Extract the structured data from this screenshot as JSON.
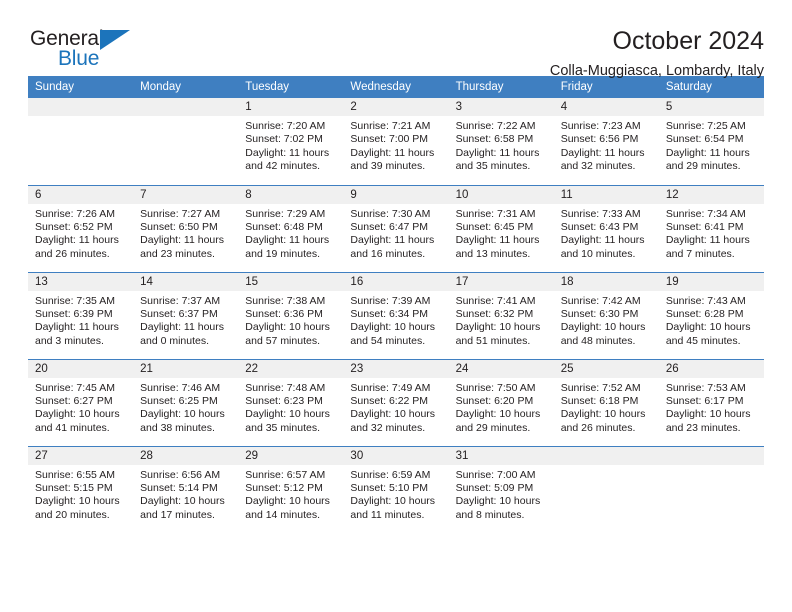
{
  "logo": {
    "text_dark": "General",
    "text_blue": "Blue",
    "triangle_icon": "triangle-icon"
  },
  "header": {
    "title": "October 2024",
    "subtitle": "Colla-Muggiasca, Lombardy, Italy"
  },
  "colors": {
    "header_blue": "#3f7fc1",
    "logo_blue": "#1c74bb",
    "daynum_bg": "#f0f0f0",
    "text": "#231f20"
  },
  "weekdays": [
    "Sunday",
    "Monday",
    "Tuesday",
    "Wednesday",
    "Thursday",
    "Friday",
    "Saturday"
  ],
  "weeks": [
    [
      {
        "day": "",
        "lines": []
      },
      {
        "day": "",
        "lines": []
      },
      {
        "day": "1",
        "lines": [
          "Sunrise: 7:20 AM",
          "Sunset: 7:02 PM",
          "Daylight: 11 hours",
          "and 42 minutes."
        ]
      },
      {
        "day": "2",
        "lines": [
          "Sunrise: 7:21 AM",
          "Sunset: 7:00 PM",
          "Daylight: 11 hours",
          "and 39 minutes."
        ]
      },
      {
        "day": "3",
        "lines": [
          "Sunrise: 7:22 AM",
          "Sunset: 6:58 PM",
          "Daylight: 11 hours",
          "and 35 minutes."
        ]
      },
      {
        "day": "4",
        "lines": [
          "Sunrise: 7:23 AM",
          "Sunset: 6:56 PM",
          "Daylight: 11 hours",
          "and 32 minutes."
        ]
      },
      {
        "day": "5",
        "lines": [
          "Sunrise: 7:25 AM",
          "Sunset: 6:54 PM",
          "Daylight: 11 hours",
          "and 29 minutes."
        ]
      }
    ],
    [
      {
        "day": "6",
        "lines": [
          "Sunrise: 7:26 AM",
          "Sunset: 6:52 PM",
          "Daylight: 11 hours",
          "and 26 minutes."
        ]
      },
      {
        "day": "7",
        "lines": [
          "Sunrise: 7:27 AM",
          "Sunset: 6:50 PM",
          "Daylight: 11 hours",
          "and 23 minutes."
        ]
      },
      {
        "day": "8",
        "lines": [
          "Sunrise: 7:29 AM",
          "Sunset: 6:48 PM",
          "Daylight: 11 hours",
          "and 19 minutes."
        ]
      },
      {
        "day": "9",
        "lines": [
          "Sunrise: 7:30 AM",
          "Sunset: 6:47 PM",
          "Daylight: 11 hours",
          "and 16 minutes."
        ]
      },
      {
        "day": "10",
        "lines": [
          "Sunrise: 7:31 AM",
          "Sunset: 6:45 PM",
          "Daylight: 11 hours",
          "and 13 minutes."
        ]
      },
      {
        "day": "11",
        "lines": [
          "Sunrise: 7:33 AM",
          "Sunset: 6:43 PM",
          "Daylight: 11 hours",
          "and 10 minutes."
        ]
      },
      {
        "day": "12",
        "lines": [
          "Sunrise: 7:34 AM",
          "Sunset: 6:41 PM",
          "Daylight: 11 hours",
          "and 7 minutes."
        ]
      }
    ],
    [
      {
        "day": "13",
        "lines": [
          "Sunrise: 7:35 AM",
          "Sunset: 6:39 PM",
          "Daylight: 11 hours",
          "and 3 minutes."
        ]
      },
      {
        "day": "14",
        "lines": [
          "Sunrise: 7:37 AM",
          "Sunset: 6:37 PM",
          "Daylight: 11 hours",
          "and 0 minutes."
        ]
      },
      {
        "day": "15",
        "lines": [
          "Sunrise: 7:38 AM",
          "Sunset: 6:36 PM",
          "Daylight: 10 hours",
          "and 57 minutes."
        ]
      },
      {
        "day": "16",
        "lines": [
          "Sunrise: 7:39 AM",
          "Sunset: 6:34 PM",
          "Daylight: 10 hours",
          "and 54 minutes."
        ]
      },
      {
        "day": "17",
        "lines": [
          "Sunrise: 7:41 AM",
          "Sunset: 6:32 PM",
          "Daylight: 10 hours",
          "and 51 minutes."
        ]
      },
      {
        "day": "18",
        "lines": [
          "Sunrise: 7:42 AM",
          "Sunset: 6:30 PM",
          "Daylight: 10 hours",
          "and 48 minutes."
        ]
      },
      {
        "day": "19",
        "lines": [
          "Sunrise: 7:43 AM",
          "Sunset: 6:28 PM",
          "Daylight: 10 hours",
          "and 45 minutes."
        ]
      }
    ],
    [
      {
        "day": "20",
        "lines": [
          "Sunrise: 7:45 AM",
          "Sunset: 6:27 PM",
          "Daylight: 10 hours",
          "and 41 minutes."
        ]
      },
      {
        "day": "21",
        "lines": [
          "Sunrise: 7:46 AM",
          "Sunset: 6:25 PM",
          "Daylight: 10 hours",
          "and 38 minutes."
        ]
      },
      {
        "day": "22",
        "lines": [
          "Sunrise: 7:48 AM",
          "Sunset: 6:23 PM",
          "Daylight: 10 hours",
          "and 35 minutes."
        ]
      },
      {
        "day": "23",
        "lines": [
          "Sunrise: 7:49 AM",
          "Sunset: 6:22 PM",
          "Daylight: 10 hours",
          "and 32 minutes."
        ]
      },
      {
        "day": "24",
        "lines": [
          "Sunrise: 7:50 AM",
          "Sunset: 6:20 PM",
          "Daylight: 10 hours",
          "and 29 minutes."
        ]
      },
      {
        "day": "25",
        "lines": [
          "Sunrise: 7:52 AM",
          "Sunset: 6:18 PM",
          "Daylight: 10 hours",
          "and 26 minutes."
        ]
      },
      {
        "day": "26",
        "lines": [
          "Sunrise: 7:53 AM",
          "Sunset: 6:17 PM",
          "Daylight: 10 hours",
          "and 23 minutes."
        ]
      }
    ],
    [
      {
        "day": "27",
        "lines": [
          "Sunrise: 6:55 AM",
          "Sunset: 5:15 PM",
          "Daylight: 10 hours",
          "and 20 minutes."
        ]
      },
      {
        "day": "28",
        "lines": [
          "Sunrise: 6:56 AM",
          "Sunset: 5:14 PM",
          "Daylight: 10 hours",
          "and 17 minutes."
        ]
      },
      {
        "day": "29",
        "lines": [
          "Sunrise: 6:57 AM",
          "Sunset: 5:12 PM",
          "Daylight: 10 hours",
          "and 14 minutes."
        ]
      },
      {
        "day": "30",
        "lines": [
          "Sunrise: 6:59 AM",
          "Sunset: 5:10 PM",
          "Daylight: 10 hours",
          "and 11 minutes."
        ]
      },
      {
        "day": "31",
        "lines": [
          "Sunrise: 7:00 AM",
          "Sunset: 5:09 PM",
          "Daylight: 10 hours",
          "and 8 minutes."
        ]
      },
      {
        "day": "",
        "lines": []
      },
      {
        "day": "",
        "lines": []
      }
    ]
  ]
}
